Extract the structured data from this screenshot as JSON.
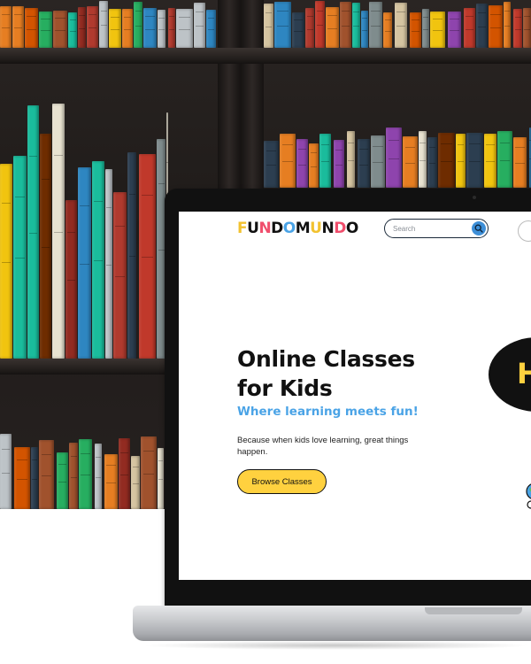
{
  "site": {
    "logo": {
      "text": "FUNDOMUNDO",
      "letter_colors": [
        "#f2c230",
        "#111111",
        "#f04e6c",
        "#111111",
        "#4aa3e6",
        "#111111",
        "#f2c230",
        "#111111",
        "#f04e6c",
        "#111111"
      ]
    },
    "search": {
      "placeholder": "Search",
      "icon": "search-icon"
    },
    "hero": {
      "title": "Online Classes for Kids",
      "subtitle": "Where learning meets fun!",
      "body": "Because when kids love learning, great things happen.",
      "cta_label": "Browse Classes"
    },
    "bubble_letter": "H"
  },
  "colors": {
    "accent_yellow": "#ffd13f",
    "accent_blue": "#4aa3e6",
    "text_dark": "#111111",
    "background": "#ffffff"
  }
}
